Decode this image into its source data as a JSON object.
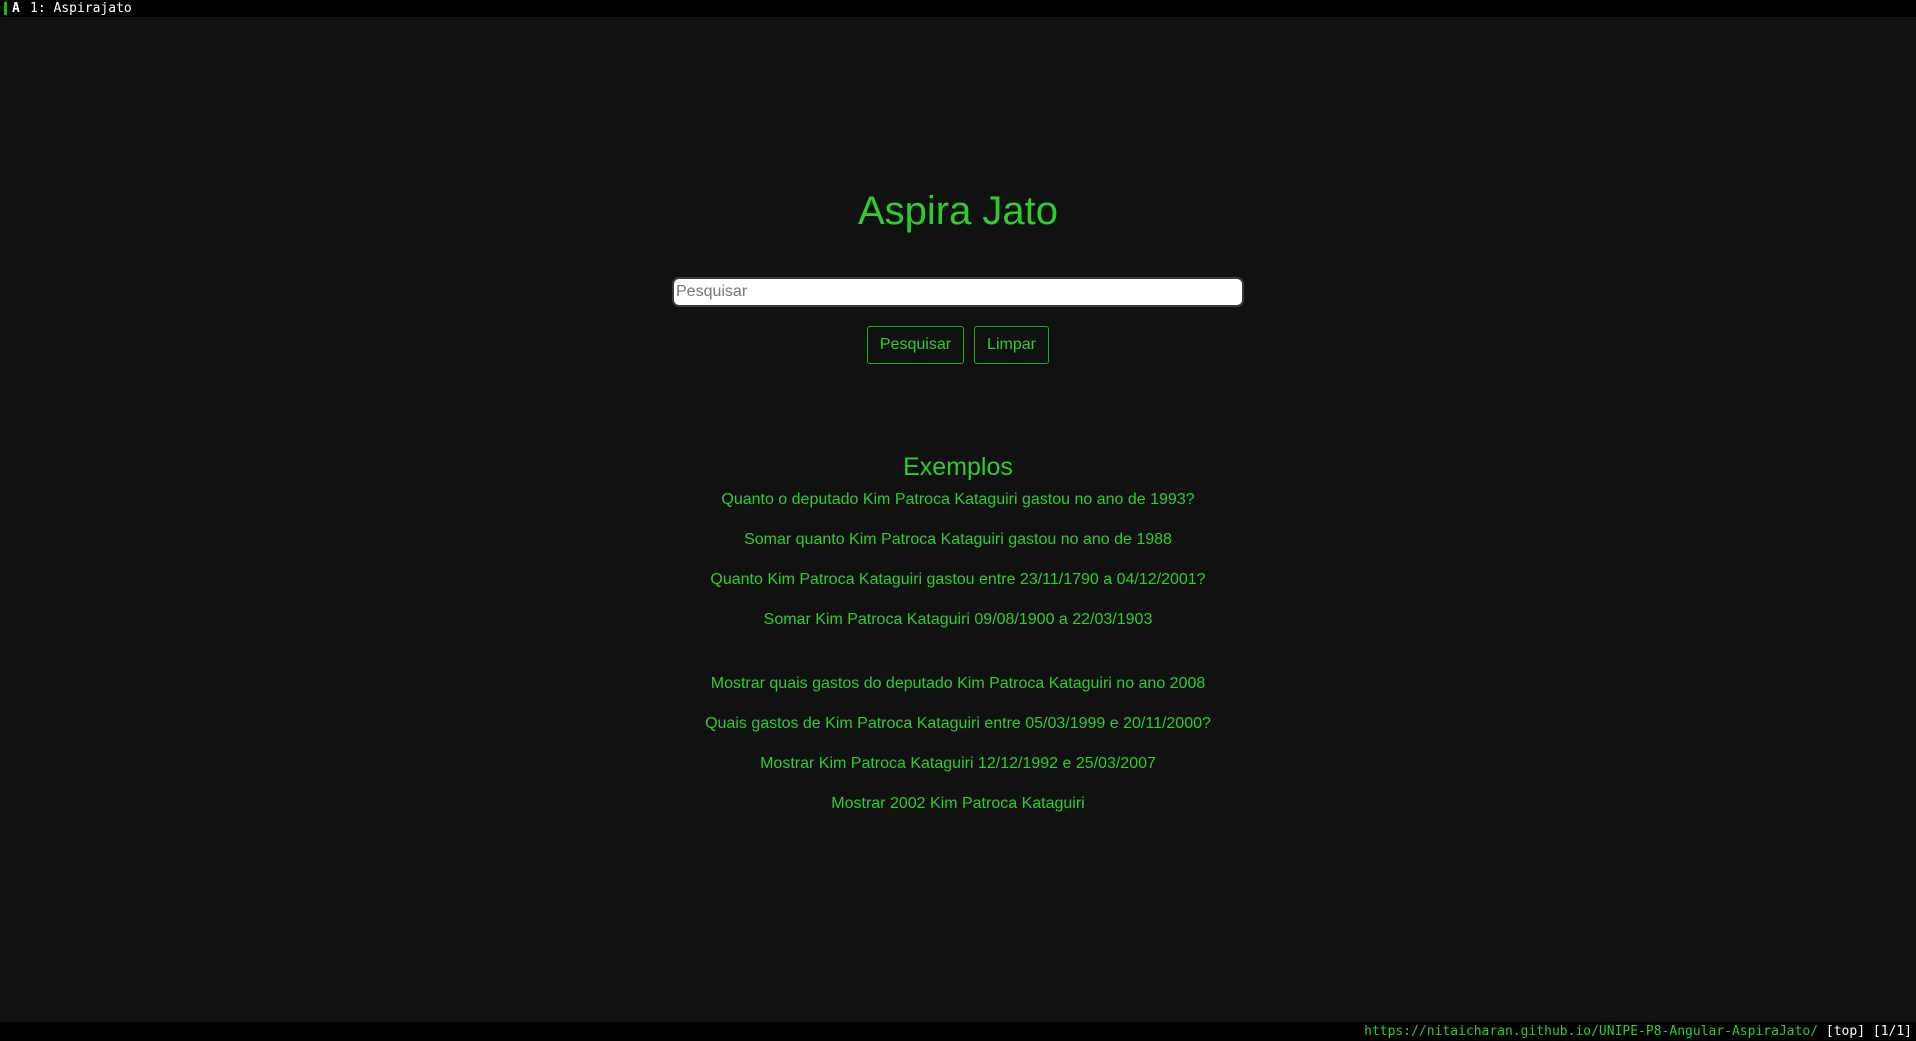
{
  "tabbar": {
    "icon": "A",
    "title": "1: Aspirajato"
  },
  "app": {
    "title": "Aspira Jato"
  },
  "search": {
    "placeholder": "Pesquisar",
    "value": ""
  },
  "buttons": {
    "search_label": "Pesquisar",
    "clear_label": "Limpar"
  },
  "examples": {
    "heading": "Exemplos",
    "items": [
      "Quanto o deputado Kim Patroca Kataguiri gastou no ano de 1993?",
      "Somar quanto Kim Patroca Kataguiri gastou no ano de 1988",
      "Quanto Kim Patroca Kataguiri gastou entre 23/11/1790 a 04/12/2001?",
      "Somar Kim Patroca Kataguiri 09/08/1900 a 22/03/1903",
      "Mostrar quais gastos do deputado Kim Patroca Kataguiri no ano 2008",
      "Quais gastos de Kim Patroca Kataguiri entre 05/03/1999 e 20/11/2000?",
      "Mostrar Kim Patroca Kataguiri 12/12/1992 e 25/03/2007",
      "Mostrar 2002 Kim Patroca Kataguiri"
    ]
  },
  "statusbar": {
    "url": "https://nitaicharan.github.io/UNIPE-P8-Angular-AspiraJato/",
    "position": " [top] [1/1]"
  },
  "colors": {
    "accent": "#2ecc2e",
    "background": "#111111"
  }
}
